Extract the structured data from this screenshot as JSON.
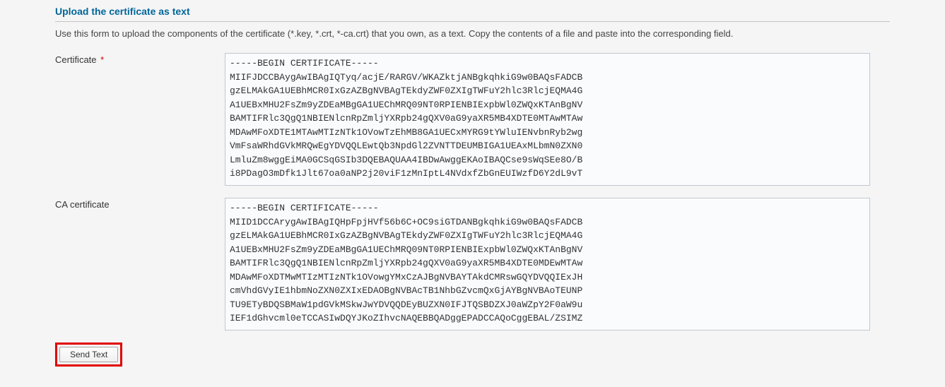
{
  "section": {
    "title": "Upload the certificate as text",
    "description": "Use this form to upload the components of the certificate (*.key, *.crt, *-ca.crt) that you own, as a text. Copy the contents of a file and paste into the corresponding field."
  },
  "fields": {
    "certificate": {
      "label": "Certificate",
      "required": "*",
      "value": "-----BEGIN CERTIFICATE-----\nMIIFJDCCBAygAwIBAgIQTyq/acjE/RARGV/WKAZktjANBgkqhkiG9w0BAQsFADCB\ngzELMAkGA1UEBhMCR0IxGzAZBgNVBAgTEkdyZWF0ZXIgTWFuY2hlc3RlcjEQMA4G\nA1UEBxMHU2FsZm9yZDEaMBgGA1UEChMRQ09NT0RPIENBIExpbWl0ZWQxKTAnBgNV\nBAMTIFRlc3QgQ1NBIENlcnRpZmljYXRpb24gQXV0aG9yaXR5MB4XDTE0MTAwMTAw\nMDAwMFoXDTE1MTAwMTIzNTk1OVowTzEhMB8GA1UECxMYRG9tYWluIENvbnRyb2wg\nVmFsaWRhdGVkMRQwEgYDVQQLEwtQb3NpdGl2ZVNTTDEUMBIGA1UEAxMLbmN0ZXN0\nLmluZm8wggEiMA0GCSqGSIb3DQEBAQUAA4IBDwAwggEKAoIBAQCse9sWqSEe8O/B\ni8PDagO3mDfk1Jlt67oa0aNP2j20viF1zMnIptL4NVdxfZbGnEUIWzfD6Y2dL9vT\n"
    },
    "ca_certificate": {
      "label": "CA certificate",
      "value": "-----BEGIN CERTIFICATE-----\nMIID1DCCArygAwIBAgIQHpFpjHVf56b6C+OC9siGTDANBgkqhkiG9w0BAQsFADCB\ngzELMAkGA1UEBhMCR0IxGzAZBgNVBAgTEkdyZWF0ZXIgTWFuY2hlc3RlcjEQMA4G\nA1UEBxMHU2FsZm9yZDEaMBgGA1UEChMRQ09NT0RPIENBIExpbWl0ZWQxKTAnBgNV\nBAMTIFRlc3QgQ1NBIENlcnRpZmljYXRpb24gQXV0aG9yaXR5MB4XDTE0MDEwMTAw\nMDAwMFoXDTMwMTIzMTIzNTk1OVowgYMxCzAJBgNVBAYTAkdCMRswGQYDVQQIExJH\ncmVhdGVyIE1hbmNoZXN0ZXIxEDAOBgNVBAcTB1NhbGZvcmQxGjAYBgNVBAoTEUNP\nTU9ETyBDQSBMaW1pdGVkMSkwJwYDVQQDEyBUZXN0IFJTQSBDZXJ0aWZpY2F0aW9u\nIEF1dGhvcml0eTCCASIwDQYJKoZIhvcNAQEBBQADggEPADCCAQoCggEBAL/ZSIMZ\n"
    }
  },
  "actions": {
    "send_label": "Send Text"
  }
}
